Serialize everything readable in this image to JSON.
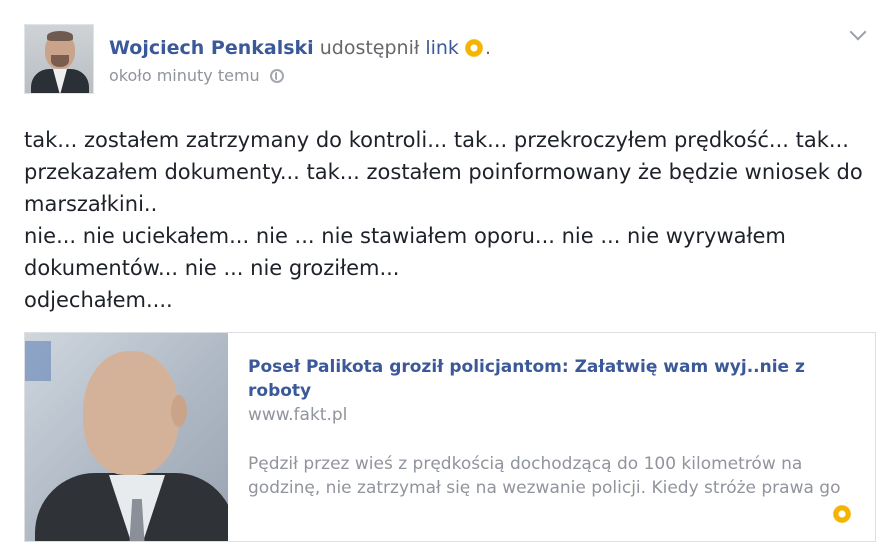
{
  "post": {
    "author": "Wojciech Penkalski",
    "verb": "udostępnił",
    "object_link": "link",
    "period": ".",
    "timestamp": "około minuty temu",
    "privacy_icon": "globe-icon",
    "menu_icon": "chevron-down-icon",
    "activity_icon": "yellow-dot-icon",
    "text_lines": [
      "tak... zostałem zatrzymany do kontroli... tak... przekroczyłem prędkość... tak...",
      "przekazałem dokumenty... tak... zostałem poinformowany że będzie wniosek do",
      "marszałkini..",
      "nie... nie uciekałem... nie ... nie stawiałem oporu... nie ... nie wyrywałem",
      "dokumentów... nie ... nie groziłem...",
      "odjechałem...."
    ]
  },
  "shared_link": {
    "title": "Poseł Palikota groził policjantom: Załatwię wam wyj..nie z roboty",
    "domain": "www.fakt.pl",
    "description": "Pędził przez wieś z prędkością dochodzącą do 100 kilometrów na godzinę, nie zatrzymał się na wezwanie policji. Kiedy stróże prawa go"
  },
  "colors": {
    "link_blue": "#3b5998",
    "muted_gray": "#90949c",
    "text_dark": "#1d2129",
    "accent_yellow": "#f4b400"
  }
}
